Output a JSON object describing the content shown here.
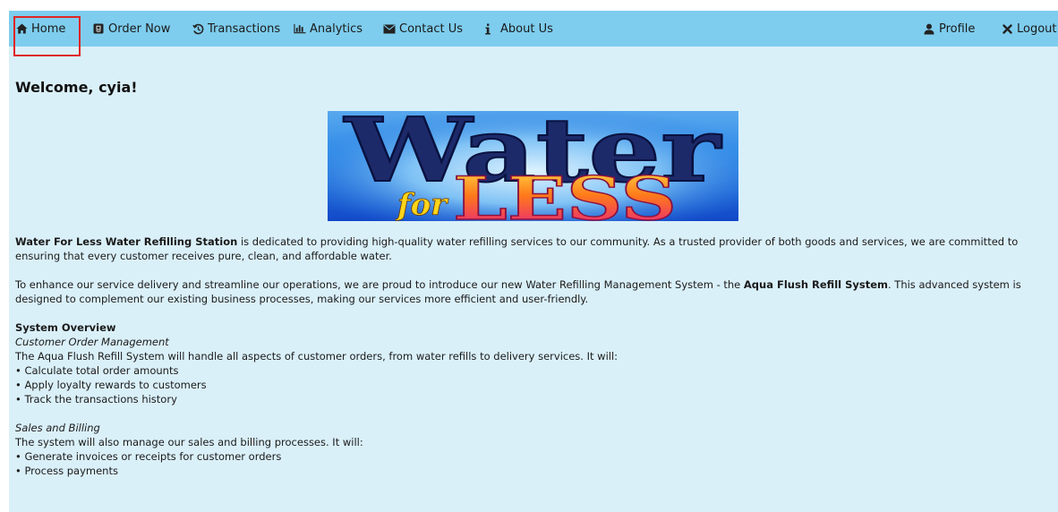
{
  "nav": {
    "home": "Home",
    "order_now": "Order Now",
    "transactions": "Transactions",
    "analytics": "Analytics",
    "contact_us": "Contact Us",
    "about_us": "About Us",
    "profile": "Profile",
    "logout": "Logout"
  },
  "welcome": "Welcome, cyia!",
  "logo": {
    "word_top": "Water",
    "word_for": "for",
    "word_less": "LESS"
  },
  "intro": {
    "brand": "Water For Less Water Refilling Station",
    "p1_rest": " is dedicated to providing high-quality water refilling services to our community. As a trusted provider of both goods and services, we are committed to ensuring that every customer receives pure, clean, and affordable water.",
    "p2_start": "To enhance our service delivery and streamline our operations, we are proud to introduce our new Water Refilling Management System - the ",
    "p2_system": "Aqua Flush Refill System",
    "p2_end": ". This advanced system is designed to complement our existing business processes, making our services more efficient and user-friendly."
  },
  "overview": {
    "title": "System Overview",
    "section1": {
      "subtitle": "Customer Order Management",
      "text": "The Aqua Flush Refill System will handle all aspects of customer orders, from water refills to delivery services. It will:",
      "bullets": [
        "• Calculate total order amounts",
        "• Apply loyalty rewards to customers",
        "• Track the transactions history"
      ]
    },
    "section2": {
      "subtitle": "Sales and Billing",
      "text": "The system will also manage our sales and billing processes. It will:",
      "bullets": [
        "• Generate invoices or receipts for customer orders",
        "• Process payments"
      ]
    }
  },
  "colors": {
    "navbar": "#7ecdee",
    "background": "#daf0f9",
    "highlight": "#e02424"
  }
}
